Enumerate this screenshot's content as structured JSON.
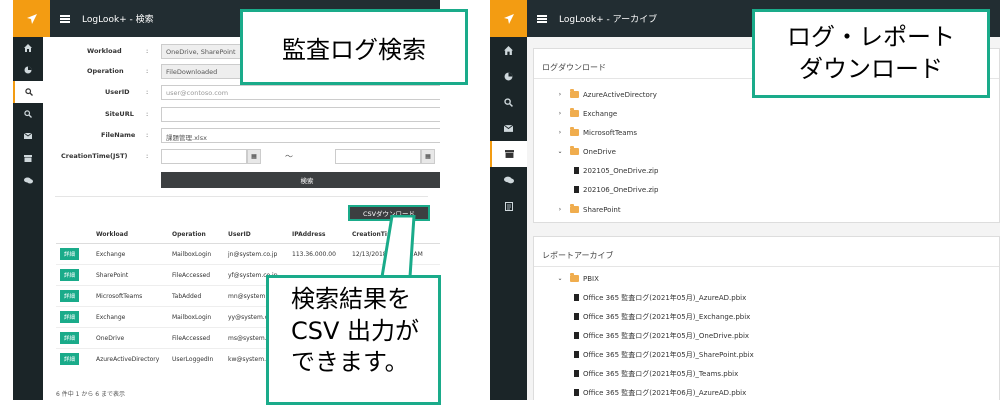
{
  "left_window": {
    "app_title": "LogLook+ - 検索",
    "form": {
      "workload_label": "Workload",
      "workload_value": "OneDrive, SharePoint",
      "operation_label": "Operation",
      "operation_value": "FileDownloaded",
      "userid_label": "UserID",
      "userid_placeholder": "user@contoso.com",
      "siteurl_label": "SiteURL",
      "siteurl_value": "",
      "filename_label": "FileName",
      "filename_value": "課題管理.xlsx",
      "creationtime_label": "CreationTime(JST)",
      "tilde": "～",
      "search_button": "検索",
      "colon": ":"
    },
    "csv_button": "CSVダウンロード",
    "table": {
      "columns": [
        "",
        "Workload",
        "Operation",
        "UserID",
        "IPAddress",
        "CreationTime"
      ],
      "detail_label": "詳細",
      "rows": [
        {
          "workload": "Exchange",
          "operation": "MailboxLogin",
          "userid": "jn@system.co.jp",
          "ip": "113.36.000.00",
          "time": "12/13/2018 3:58:48 AM"
        },
        {
          "workload": "SharePoint",
          "operation": "FileAccessed",
          "userid": "yf@system.co.jp",
          "ip": "",
          "time": ""
        },
        {
          "workload": "MicrosoftTeams",
          "operation": "TabAdded",
          "userid": "mn@system.co.jp",
          "ip": "",
          "time": ""
        },
        {
          "workload": "Exchange",
          "operation": "MailboxLogin",
          "userid": "yy@system.co.jp",
          "ip": "",
          "time": ""
        },
        {
          "workload": "OneDrive",
          "operation": "FileAccessed",
          "userid": "ms@system.co.jp",
          "ip": "",
          "time": ""
        },
        {
          "workload": "AzureActiveDirectory",
          "operation": "UserLoggedIn",
          "userid": "kw@system.co.jp",
          "ip": "",
          "time": ""
        }
      ]
    },
    "footer": "6 件中 1 から 6 まで表示"
  },
  "right_window": {
    "app_title": "LogLook+ - アーカイブ",
    "log_download_header": "ログダウンロード",
    "tree": [
      {
        "label": "AzureActiveDirectory",
        "type": "folder",
        "expanded": false
      },
      {
        "label": "Exchange",
        "type": "folder",
        "expanded": false
      },
      {
        "label": "MicrosoftTeams",
        "type": "folder",
        "expanded": false
      },
      {
        "label": "OneDrive",
        "type": "folder",
        "expanded": true
      },
      {
        "label": "202105_OneDrive.zip",
        "type": "file"
      },
      {
        "label": "202106_OneDrive.zip",
        "type": "file"
      },
      {
        "label": "SharePoint",
        "type": "folder",
        "expanded": false
      }
    ],
    "report_archive_header": "レポートアーカイブ",
    "report_folder": "PBIX",
    "report_files": [
      "Office 365 監査ログ(2021年05月)_AzureAD.pbix",
      "Office 365 監査ログ(2021年05月)_Exchange.pbix",
      "Office 365 監査ログ(2021年05月)_OneDrive.pbix",
      "Office 365 監査ログ(2021年05月)_SharePoint.pbix",
      "Office 365 監査ログ(2021年05月)_Teams.pbix",
      "Office 365 監査ログ(2021年06月)_AzureAD.pbix"
    ]
  },
  "callouts": {
    "search_title": "監査ログ検索",
    "download_title_line1": "ログ・レポート",
    "download_title_line2": "ダウンロード",
    "csv_note_line1": "検索結果を",
    "csv_note_line2": "CSV 出力が",
    "csv_note_line3": "できます。"
  },
  "colors": {
    "accent_teal": "#1aab8a",
    "logo_orange": "#f39c12",
    "topbar_dark": "#222d32",
    "sidenav_dark": "#1b2528",
    "folder_yellow": "#f0ad4e"
  }
}
